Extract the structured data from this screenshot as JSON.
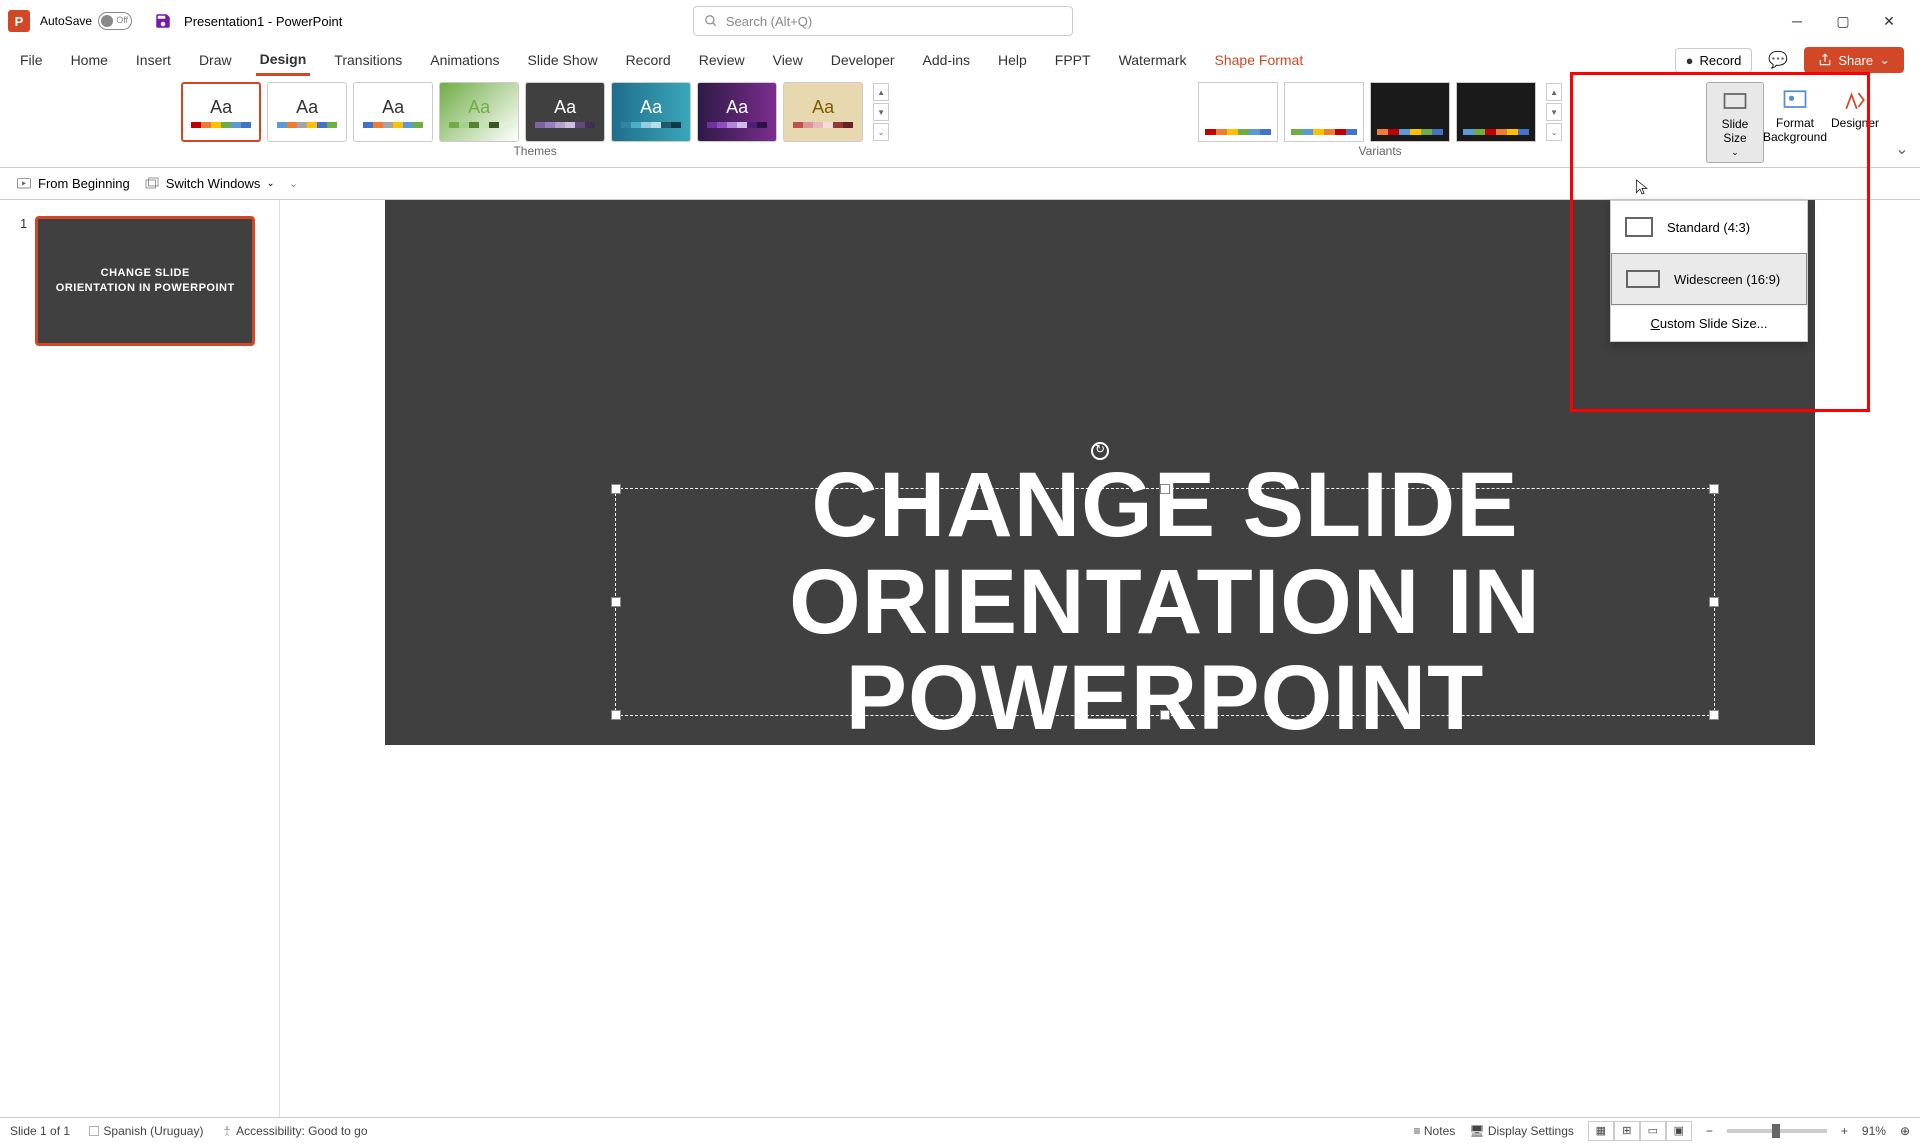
{
  "titlebar": {
    "autosave_label": "AutoSave",
    "doc_title": "Presentation1 - PowerPoint",
    "search_placeholder": "Search (Alt+Q)"
  },
  "tabs": {
    "file": "File",
    "home": "Home",
    "insert": "Insert",
    "draw": "Draw",
    "design": "Design",
    "transitions": "Transitions",
    "animations": "Animations",
    "slideshow": "Slide Show",
    "record": "Record",
    "review": "Review",
    "view": "View",
    "developer": "Developer",
    "addins": "Add-ins",
    "help": "Help",
    "fppt": "FPPT",
    "watermark": "Watermark",
    "shape_format": "Shape Format"
  },
  "ribbon_right": {
    "record": "Record",
    "share": "Share"
  },
  "groups": {
    "themes": "Themes",
    "variants": "Variants"
  },
  "customize": {
    "slide_size": "Slide Size",
    "format_background": "Format Background",
    "designer": "Designer",
    "designer_suffix": "er"
  },
  "quick": {
    "from_beginning": "From Beginning",
    "switch_windows": "Switch Windows"
  },
  "slide": {
    "number": "1",
    "thumb_line1": "CHANGE SLIDE",
    "thumb_line2": "ORIENTATION IN POWERPOINT",
    "title_line1": "CHANGE SLIDE",
    "title_line2": "ORIENTATION IN POWERPOINT"
  },
  "menu": {
    "standard": "Standard (4:3)",
    "widescreen": "Widescreen (16:9)",
    "custom_prefix": "C",
    "custom_rest": "ustom Slide Size..."
  },
  "status": {
    "slide_info": "Slide 1 of 1",
    "language": "Spanish (Uruguay)",
    "accessibility": "Accessibility: Good to go",
    "notes": "Notes",
    "display": "Display Settings",
    "zoom": "91%"
  },
  "theme_colors": {
    "t1": [
      "#c00000",
      "#ed7d31",
      "#ffc000",
      "#70ad47",
      "#5b9bd5",
      "#4472c4"
    ],
    "t2": [
      "#5b9bd5",
      "#ed7d31",
      "#a5a5a5",
      "#ffc000",
      "#4472c4",
      "#70ad47"
    ],
    "t3": [
      "#4472c4",
      "#ed7d31",
      "#a5a5a5",
      "#ffc000",
      "#5b9bd5",
      "#70ad47"
    ],
    "t4": [
      "#70ad47",
      "#a5d18e",
      "#548235",
      "#c5e0b4",
      "#385723",
      "#e2f0d9"
    ],
    "t5": [
      "#8064a2",
      "#9a7fbf",
      "#b3a2c7",
      "#ccc1da",
      "#604a7b",
      "#403152"
    ],
    "t6": [
      "#31859c",
      "#4bacc6",
      "#93cddd",
      "#b7dee8",
      "#215968",
      "#0e3a45"
    ],
    "t7": [
      "#7030a0",
      "#8e4fbf",
      "#b084d9",
      "#d2b9ec",
      "#4b2072",
      "#2e1247"
    ],
    "t8": [
      "#c0504d",
      "#d99694",
      "#e6b9b8",
      "#f2dcdb",
      "#953735",
      "#632523"
    ]
  },
  "variant_colors": {
    "v1": [
      "#c00000",
      "#ed7d31",
      "#ffc000",
      "#70ad47",
      "#5b9bd5",
      "#4472c4"
    ],
    "v2": [
      "#70ad47",
      "#5b9bd5",
      "#ffc000",
      "#ed7d31",
      "#c00000",
      "#4472c4"
    ],
    "v3": [
      "#ed7d31",
      "#c00000",
      "#5b9bd5",
      "#ffc000",
      "#70ad47",
      "#4472c4"
    ],
    "v4": [
      "#5b9bd5",
      "#70ad47",
      "#c00000",
      "#ed7d31",
      "#ffc000",
      "#4472c4"
    ]
  }
}
